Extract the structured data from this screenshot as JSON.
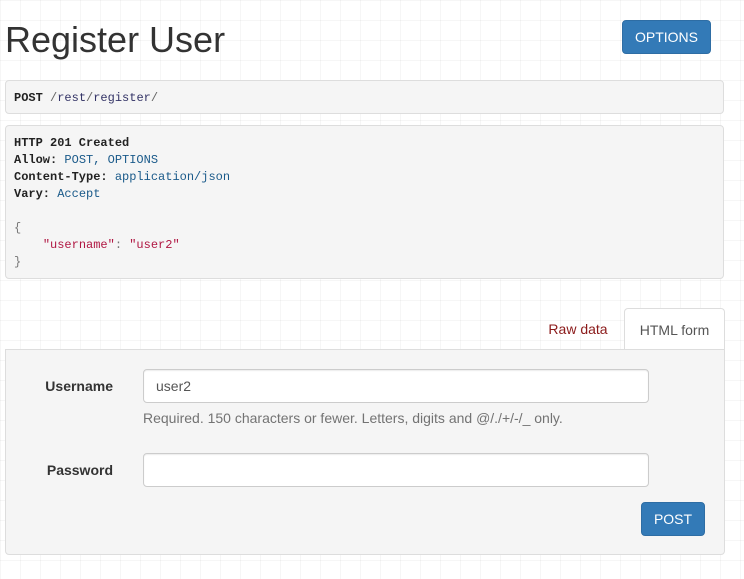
{
  "header": {
    "title": "Register User",
    "options_label": "OPTIONS"
  },
  "request": {
    "method": "POST",
    "path_sep1": "/",
    "path_seg1": "rest",
    "path_sep2": "/",
    "path_seg2": "register",
    "path_sep3": "/"
  },
  "response": {
    "status_line": "HTTP 201 Created",
    "headers": [
      {
        "key": "Allow:",
        "value": "POST, OPTIONS"
      },
      {
        "key": "Content-Type:",
        "value": "application/json"
      },
      {
        "key": "Vary:",
        "value": "Accept"
      }
    ],
    "body": {
      "open_brace": "{",
      "key": "\"username\"",
      "colon": ": ",
      "value": "\"user2\"",
      "close_brace": "}"
    }
  },
  "tabs": {
    "raw_data": "Raw data",
    "html_form": "HTML form"
  },
  "form": {
    "username_label": "Username",
    "username_value": "user2",
    "username_help": "Required. 150 characters or fewer. Letters, digits and @/./+/-/_ only.",
    "password_label": "Password",
    "password_value": "",
    "submit_label": "POST"
  },
  "colors": {
    "primary": "#337ab7",
    "link_red": "#8b1a1a",
    "json_string": "#b01642"
  }
}
